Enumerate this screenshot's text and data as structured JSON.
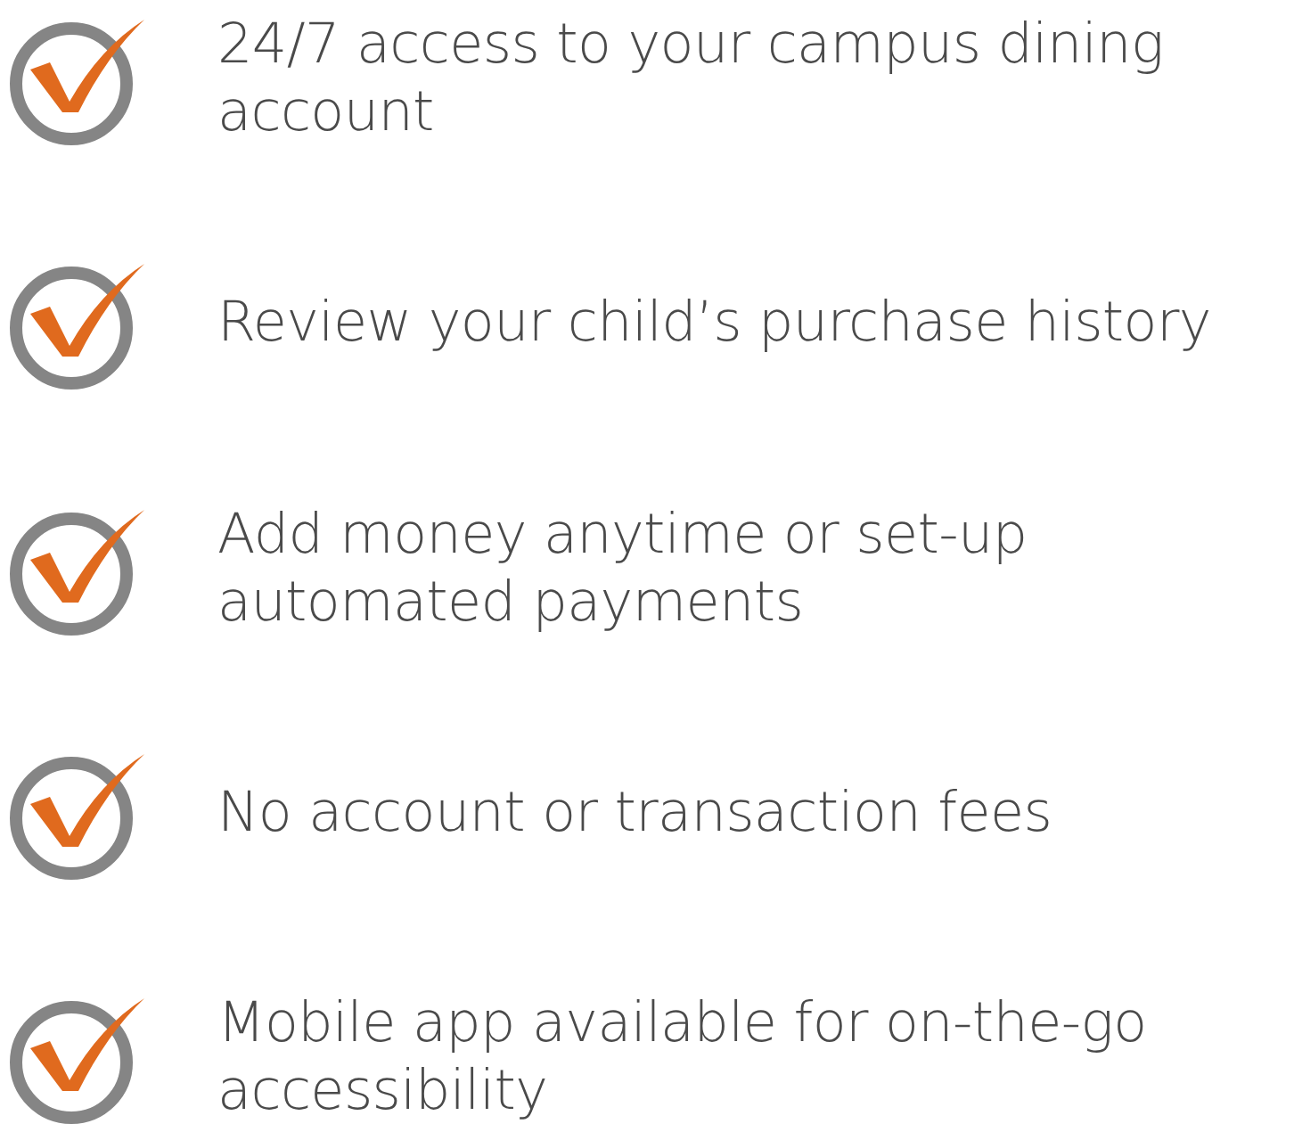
{
  "features": [
    {
      "text": "24/7 access to your campus dining account"
    },
    {
      "text": "Review your child’s purchase history"
    },
    {
      "text": "Add money anytime or set-up automated payments"
    },
    {
      "text": "No account or transaction fees"
    },
    {
      "text": "Mobile app available for on-the-go accessibility"
    }
  ]
}
